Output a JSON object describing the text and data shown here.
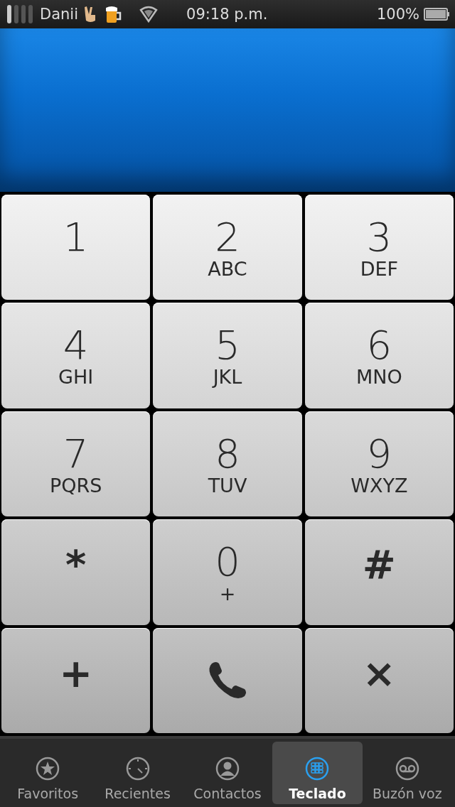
{
  "status_bar": {
    "carrier": "Danii",
    "time": "09:18 p.m.",
    "battery": "100%"
  },
  "keys": [
    {
      "kind": "digit",
      "main": "1"
    },
    {
      "kind": "digit",
      "main": "2",
      "sub": "ABC"
    },
    {
      "kind": "digit",
      "main": "3",
      "sub": "DEF"
    },
    {
      "kind": "digit",
      "main": "4",
      "sub": "GHI"
    },
    {
      "kind": "digit",
      "main": "5",
      "sub": "JKL"
    },
    {
      "kind": "digit",
      "main": "6",
      "sub": "MNO"
    },
    {
      "kind": "digit",
      "main": "7",
      "sub": "PQRS"
    },
    {
      "kind": "digit",
      "main": "8",
      "sub": "TUV"
    },
    {
      "kind": "digit",
      "main": "9",
      "sub": "WXYZ"
    },
    {
      "kind": "symbol",
      "main": "*"
    },
    {
      "kind": "digit",
      "main": "0",
      "sub": "+"
    },
    {
      "kind": "symbol",
      "main": "#"
    },
    {
      "kind": "symbol",
      "main": "+"
    },
    {
      "kind": "call"
    },
    {
      "kind": "symbol",
      "main": "×"
    }
  ],
  "tabs": [
    {
      "label": "Favoritos",
      "selected": false
    },
    {
      "label": "Recientes",
      "selected": false
    },
    {
      "label": "Contactos",
      "selected": false
    },
    {
      "label": "Teclado",
      "selected": true
    },
    {
      "label": "Buzón voz",
      "selected": false
    }
  ]
}
